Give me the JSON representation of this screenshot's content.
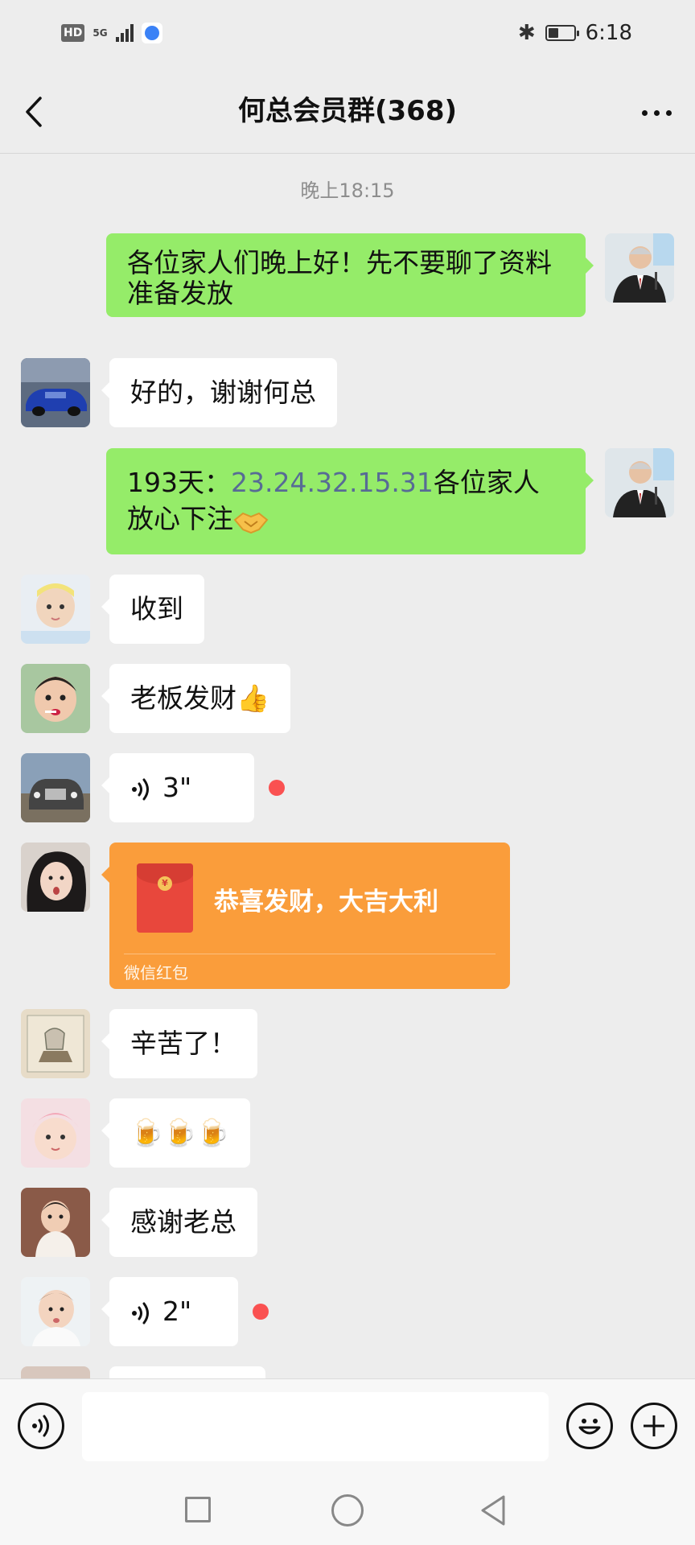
{
  "status_bar": {
    "hd": "HD",
    "network": "5G",
    "time": "6:18"
  },
  "header": {
    "title": "何总会员群(368)"
  },
  "chat": {
    "timestamp": "晚上18:15",
    "messages": [
      {
        "side": "out",
        "text": "各位家人们晚上好！先不要聊了资料准备发放"
      },
      {
        "side": "in",
        "text": "好的，谢谢何总"
      },
      {
        "side": "out",
        "prefix": "193天：",
        "link": "23.24.32.15.31",
        "suffix": "各位家人放心下注"
      },
      {
        "side": "in",
        "text": "收到"
      },
      {
        "side": "in",
        "text": "老板发财👍"
      },
      {
        "side": "in",
        "type": "voice",
        "duration": "3\""
      },
      {
        "side": "in",
        "type": "red_packet",
        "title": "恭喜发财，大吉大利",
        "label": "微信红包"
      },
      {
        "side": "in",
        "text": "辛苦了！"
      },
      {
        "side": "in",
        "text": "🍺🍺🍺"
      },
      {
        "side": "in",
        "text": "感谢老总"
      },
      {
        "side": "in",
        "type": "voice",
        "duration": "2\""
      }
    ]
  },
  "colors": {
    "out_bubble": "#95ec69",
    "in_bubble": "#ffffff",
    "link": "#576b95",
    "red_packet": "#fa9d3b",
    "unread": "#fa5151"
  },
  "icons": {
    "back": "chevron-left-icon",
    "more": "ellipsis-icon",
    "voice_mode": "voice-icon",
    "emoji": "smiley-icon",
    "add": "plus-icon"
  }
}
